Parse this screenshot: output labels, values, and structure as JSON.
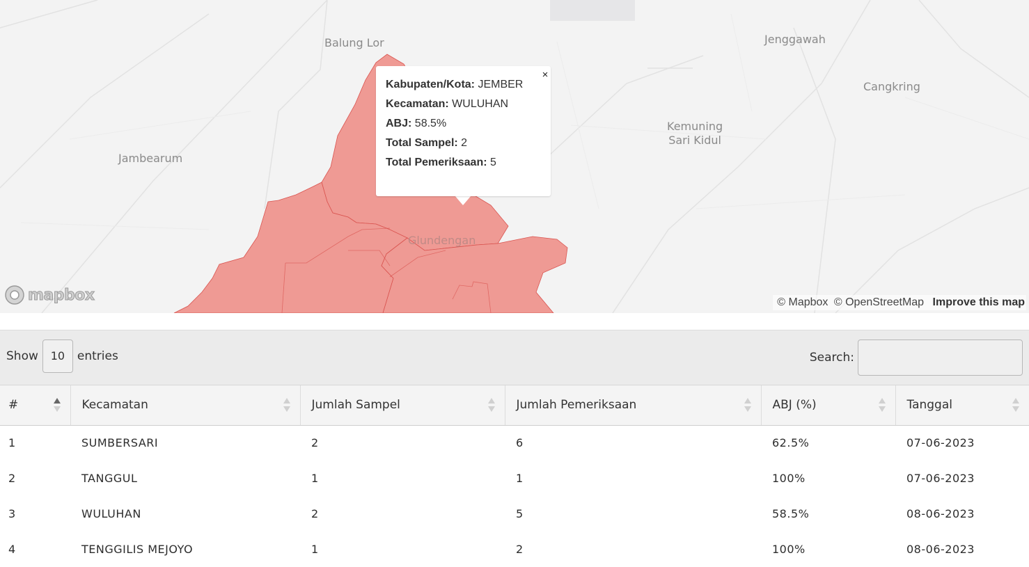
{
  "map": {
    "places": [
      {
        "name": "Balung Lor"
      },
      {
        "name": "Jenggawah"
      },
      {
        "name": "Cangkring"
      },
      {
        "name": "Jambearum"
      },
      {
        "name": "Kemuning\nSari Kidul"
      },
      {
        "name": "Glundengan"
      }
    ],
    "region_fill_color": "#ef9a94",
    "region_stroke_color": "#d9534f",
    "popup": {
      "close_symbol": "×",
      "rows": [
        {
          "label": "Kabupaten/Kota:",
          "value": "JEMBER"
        },
        {
          "label": "Kecamatan:",
          "value": "WULUHAN"
        },
        {
          "label": "ABJ:",
          "value": "58.5%"
        },
        {
          "label": "Total Sampel:",
          "value": "2"
        },
        {
          "label": "Total Pemeriksaan:",
          "value": "5"
        }
      ]
    },
    "attribution": {
      "mapbox": "© Mapbox",
      "osm": "© OpenStreetMap",
      "improve": "Improve this map"
    },
    "logo_text": "mapbox"
  },
  "table_controls": {
    "show_label": "Show",
    "length_value": "10",
    "entries_label": "entries",
    "search_label": "Search:",
    "search_value": ""
  },
  "table": {
    "columns": [
      "#",
      "Kecamatan",
      "Jumlah Sampel",
      "Jumlah Pemeriksaan",
      "ABJ (%)",
      "Tanggal"
    ],
    "rows": [
      [
        "1",
        "SUMBERSARI",
        "2",
        "6",
        "62.5%",
        "07-06-2023"
      ],
      [
        "2",
        "TANGGUL",
        "1",
        "1",
        "100%",
        "07-06-2023"
      ],
      [
        "3",
        "WULUHAN",
        "2",
        "5",
        "58.5%",
        "08-06-2023"
      ],
      [
        "4",
        "TENGGILIS MEJOYO",
        "1",
        "2",
        "100%",
        "08-06-2023"
      ]
    ]
  }
}
